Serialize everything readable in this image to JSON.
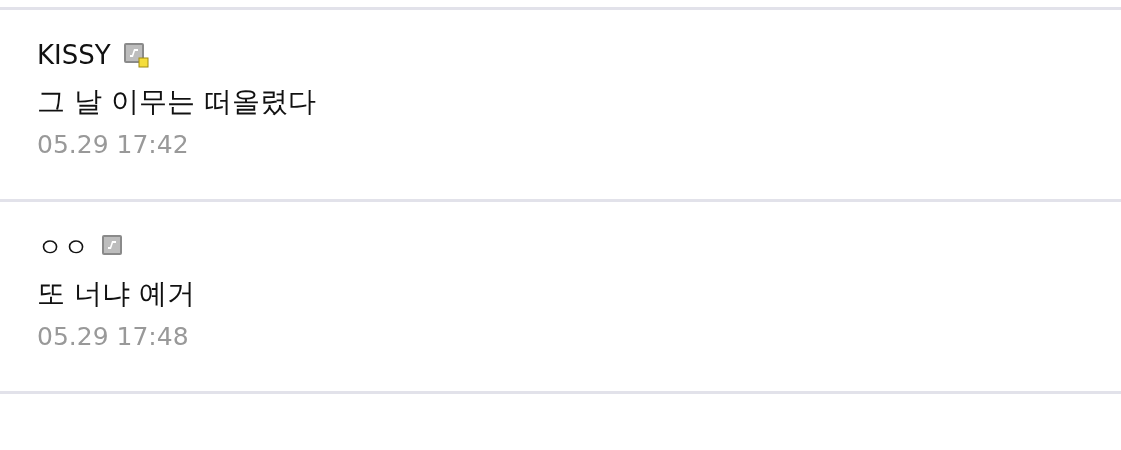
{
  "comments": [
    {
      "author": "KISSY",
      "badge_dot": true,
      "text": "그 날 이무는 떠올렸다",
      "time": "05.29 17:42"
    },
    {
      "author": "ㅇㅇ",
      "badge_dot": false,
      "text": "또 너냐 예거",
      "time": "05.29 17:48"
    }
  ]
}
